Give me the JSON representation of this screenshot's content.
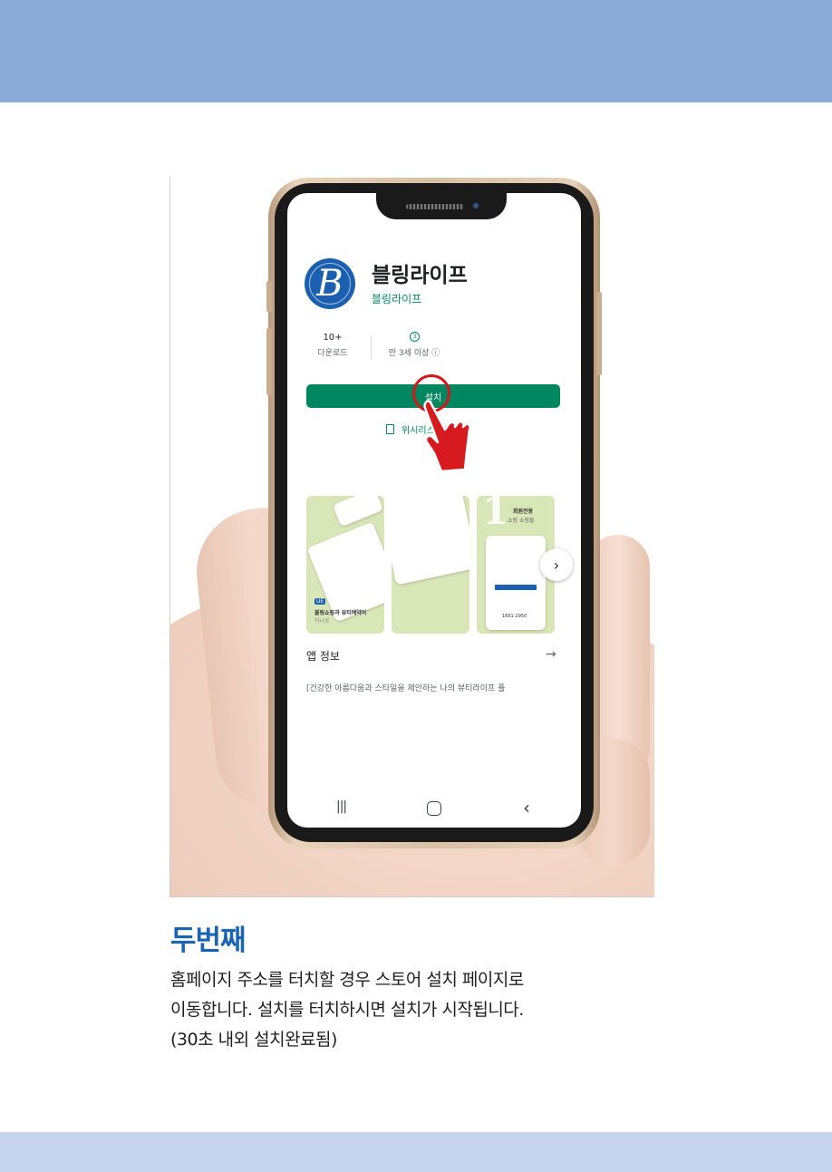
{
  "colors": {
    "top_band": "#8aaad8",
    "bottom_band": "#c5d4ec",
    "install_green": "#01875f",
    "heading_blue": "#1a64b4",
    "highlight_red": "#d4161c"
  },
  "app": {
    "logo_letter": "B",
    "title": "블링라이프",
    "developer": "블링라이프",
    "downloads_value": "10+",
    "downloads_label": "다운로드",
    "age_icon": "3",
    "age_label": "만 3세 이상 ⓘ",
    "install_label": "설치",
    "wishlist_label": "위시리스트에 추가",
    "screenshots": [
      {
        "lines": [
          "UE",
          "블링쇼핑과 뷰티예약이",
          "하나로"
        ]
      },
      {
        "lines": []
      },
      {
        "lines": [
          "회원전용",
          "쇼핑 쇼핑몰",
          "1661-2950"
        ]
      }
    ],
    "about_title": "앱 정보",
    "about_arrow": "→",
    "about_desc": "[건강한 아름다움과 스타일을 제안하는 나의 뷰티라이프 플",
    "next_arrow": "›"
  },
  "navbar": {
    "recent": "|||",
    "back": "‹"
  },
  "caption": {
    "heading": "두번째",
    "line1": "홈페이지 주소를 터치할 경우 스토어 설치 페이지로",
    "line2": "이동합니다. 설치를 터치하시면 설치가 시작됩니다.",
    "line3": "(30초 내외 설치완료됨)"
  }
}
